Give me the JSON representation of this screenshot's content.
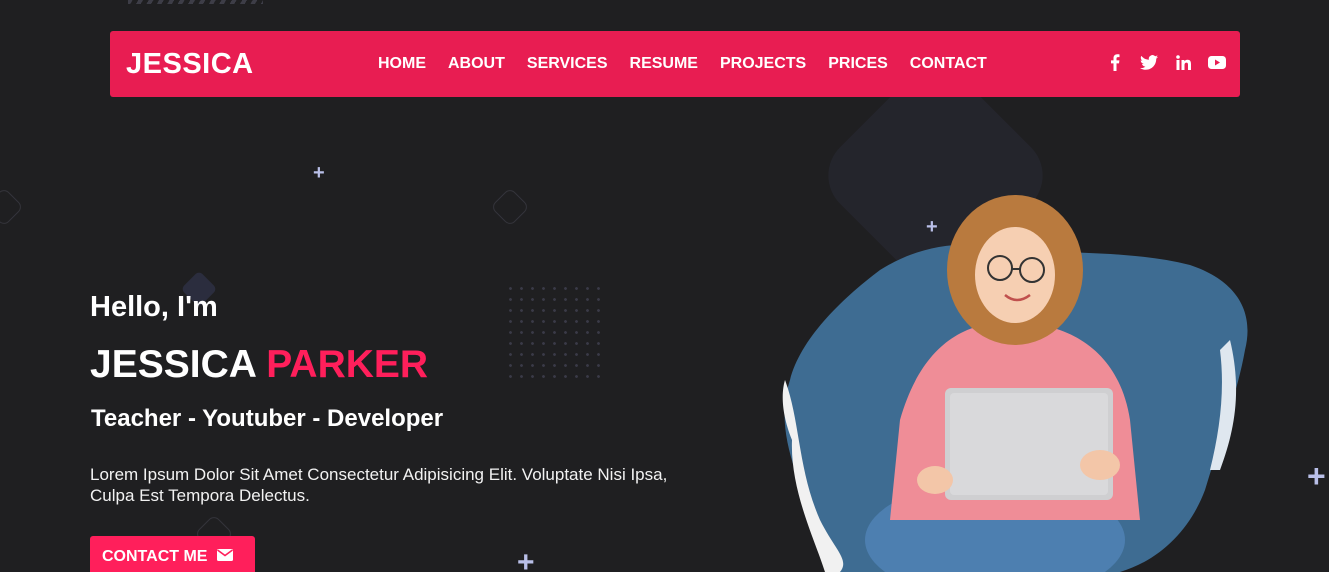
{
  "brand": {
    "logo": "JESSICA"
  },
  "nav": {
    "links": [
      {
        "label": "HOME"
      },
      {
        "label": "ABOUT"
      },
      {
        "label": "SERVICES"
      },
      {
        "label": "RESUME"
      },
      {
        "label": "PROJECTS"
      },
      {
        "label": "PRICES"
      },
      {
        "label": "CONTACT"
      }
    ]
  },
  "social": [
    {
      "icon": "facebook-icon"
    },
    {
      "icon": "twitter-icon"
    },
    {
      "icon": "linkedin-icon"
    },
    {
      "icon": "youtube-icon"
    }
  ],
  "hero": {
    "greeting": "Hello, I'm",
    "first_name": "JESSICA",
    "last_name": "PARKER",
    "roles": "Teacher - Youtuber - Developer",
    "intro": "Lorem Ipsum Dolor Sit Amet Consectetur Adipisicing Elit. Voluptate Nisi Ipsa, Culpa Est Tempora Delectus.",
    "cta_label": "CONTACT ME",
    "cta_icon": "envelope-icon"
  },
  "colors": {
    "background": "#1f1f21",
    "accent": "#e81d52",
    "accent_text": "#ff1f5b",
    "paint_splash": "#3e6c92"
  }
}
